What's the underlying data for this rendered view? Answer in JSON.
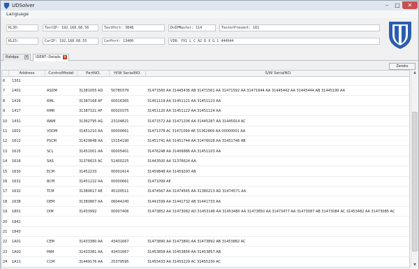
{
  "window": {
    "title": "UDSolver",
    "minimize": "–",
    "maximize": "□",
    "close": "✕"
  },
  "menu": {
    "language": "Language"
  },
  "info": {
    "kl30_label": "KL30:",
    "testip_label": "TestIP:",
    "testip_value": "192.168.68.56",
    "testport_label": "TestPort:",
    "testport_value": "3848",
    "doipmaster_label": "DoIPMaster:",
    "doipmaster_value": "114",
    "testerpresent_label": "TesterPresent:",
    "testerpresent_value": "161",
    "kl15_label": "KL15:",
    "carip_label": "CarIP:",
    "carip_value": "192.168.68.55",
    "carport_label": "CarPort:",
    "carport_value": "13400",
    "vin_label": "VIN:",
    "vin_value": "YV1 L C A2 D X G 1 444944"
  },
  "tabs": [
    {
      "label": "Rshdpa"
    },
    {
      "label": "IDENT--Details"
    }
  ],
  "toolbar": {
    "button_label": "Zereks"
  },
  "table": {
    "columns": [
      "Address",
      "ControlModel",
      "PartNO.",
      "H/W SerialNO.",
      "S/W SerialNO."
    ],
    "rows": [
      [
        "6",
        "1301",
        "",
        "",
        "",
        ""
      ],
      [
        "7",
        "1401",
        "ASDM",
        "31381055 AD",
        "50780379",
        "31471560 AA 31445436 AB 31471561 AA 31471592 AA 31471644 AA 31445442 AA 31445444 AB 31445190 AA"
      ],
      [
        "8",
        "1416",
        "RML",
        "31387168 AF",
        "00016365",
        "31451119 AA 31451121 AA 31451123 AA"
      ],
      [
        "9",
        "1417",
        "RMR",
        "31387321 AF",
        "00020375",
        "31451120 AA 31451122 AA 31451124 AA"
      ],
      [
        "10",
        "1431",
        "WAM",
        "31362795 AG",
        "23104821",
        "31471572 AA 31471206 AA 31445287 AA 31445914 AC"
      ],
      [
        "11",
        "1601",
        "VDDM",
        "31451210 AA",
        "00000661",
        "31471378 AC 31471099 AE 31362669 AA 00000001 AA"
      ],
      [
        "12",
        "1612",
        "PSCM",
        "31429848 AA",
        "15154190",
        "31451741 AA 31451744 AA 31476028 AA 31451746 AB"
      ],
      [
        "13",
        "1615",
        "SCL",
        "31451001 AA",
        "00005401",
        "31476248 AA 31406886 AA 31451103 AA"
      ],
      [
        "14",
        "1616",
        "SAS",
        "31376615 AC",
        "51400225",
        "31443500 AA 31376624 AA"
      ],
      [
        "15",
        "1630",
        "ECM",
        "31452233",
        "00002414",
        "31459848 AA 31459293 AB"
      ],
      [
        "16",
        "1631",
        "BCM",
        "31451222 AA",
        "00000661",
        "31471099 AE"
      ],
      [
        "17",
        "1632",
        "TCM",
        "31380617 AE",
        "45100511",
        "31474567 AA 31474565 AA 31380213 AD 31474571 AA"
      ],
      [
        "18",
        "1638",
        "DEM",
        "31380867 AA",
        "06044240",
        "31441599 AA 31441732 AB 31441733 AA"
      ],
      [
        "19",
        "1801",
        "DIM",
        "31433992",
        "00007406",
        "31473852 AA 31473082 AD 31453146 AA 31453480 AA 31473850 AA 31473477 AA 31473087 AB 31473084 AC 31453482 AA 31473085 AC"
      ],
      [
        "20",
        "1841",
        "",
        "",
        "",
        ""
      ],
      [
        "21",
        "1843",
        "",
        "",
        "",
        ""
      ],
      [
        "22",
        "1A01",
        "CEM",
        "31433380 AA",
        "43431667",
        "31473890 AA 31473891 AA 31473892 AB 31453882 AC"
      ],
      [
        "23",
        "1A02",
        "PAM",
        "31433381 AA",
        "43431667",
        "31453858 AA 31453856 AA 31453857 AB"
      ],
      [
        "24",
        "1A11",
        "CCM",
        "31449176 AA",
        "25379595",
        "31455433 AA 31455229 AC 31455230 AC"
      ]
    ]
  },
  "scrollbar": {
    "up": "▲",
    "down": "▼"
  },
  "colors": {
    "close": "#c75050",
    "logo_blue": "#2a5db0",
    "tab_close": "#d24a2b"
  }
}
